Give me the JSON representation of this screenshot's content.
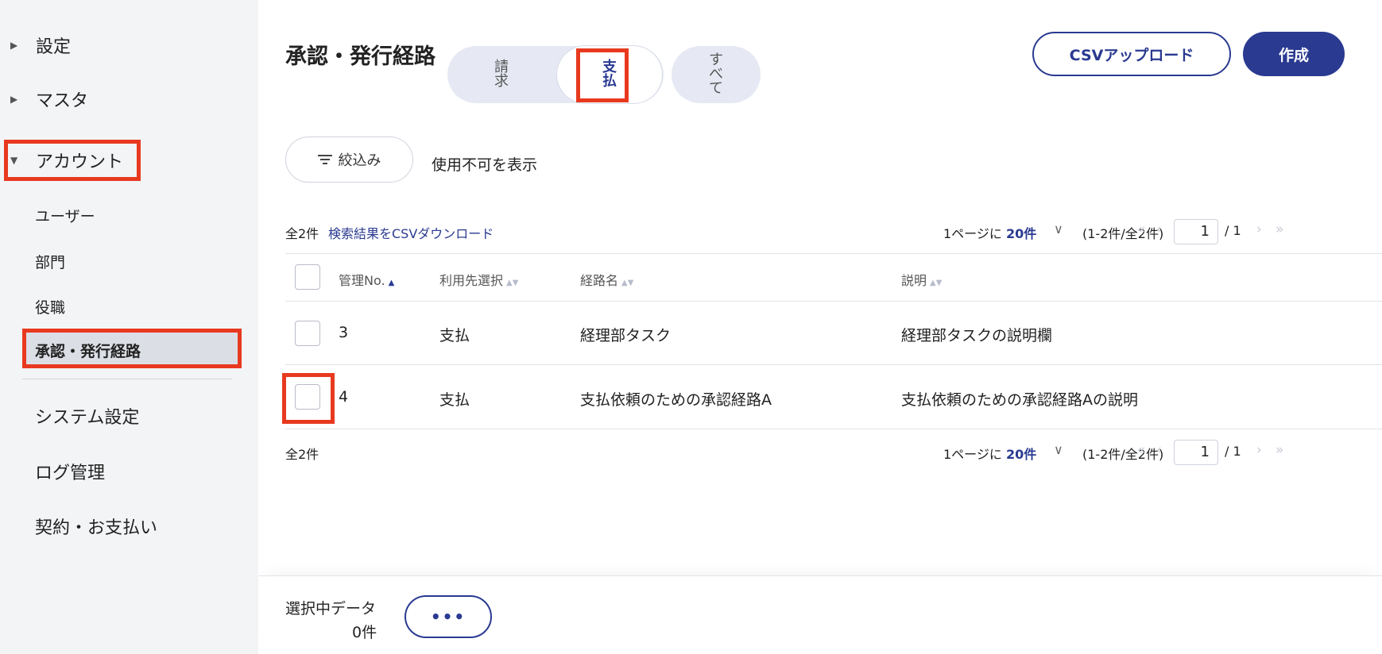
{
  "sidebar": {
    "settings": "設定",
    "master": "マスタ",
    "account": "アカウント",
    "account_children": [
      "ユーザー",
      "部門",
      "役職",
      "承認・発行経路"
    ],
    "system_settings": "システム設定",
    "log_management": "ログ管理",
    "contract_payment": "契約・お支払い",
    "collapsed_icon": "▶",
    "expanded_icon": "▼"
  },
  "header": {
    "title": "承認・発行経路",
    "segments": [
      "請求",
      "支払",
      "すべて"
    ],
    "selected_segment": "支払",
    "csv_upload": "CSVアップロード",
    "create": "作成"
  },
  "filters": {
    "filter_label": "絞込み",
    "show_disabled": "使用不可を表示"
  },
  "pagination_top": {
    "total": "全2件",
    "download": "検索結果をCSVダウンロード",
    "per_page_prefix": "1ページに",
    "per_page": "20件",
    "range": "(1-2件/全2件)",
    "current_page": "1",
    "total_pages": "/ 1"
  },
  "pagination_bottom": {
    "total": "全2件",
    "per_page_prefix": "1ページに",
    "per_page": "20件",
    "range": "(1-2件/全2件)",
    "current_page": "1",
    "total_pages": "/ 1"
  },
  "table": {
    "columns": [
      "管理No.",
      "利用先選択",
      "経路名",
      "説明"
    ],
    "rows": [
      {
        "no": "3",
        "usage": "支払",
        "name": "経理部タスク",
        "description": "経理部タスクの説明欄"
      },
      {
        "no": "4",
        "usage": "支払",
        "name": "支払依頼のための承認経路A",
        "description": "支払依頼のための承認経路Aの説明"
      }
    ]
  },
  "footer": {
    "selected_label": "選択中データ",
    "selected_count": "0件",
    "more": "•••"
  },
  "colors": {
    "accent": "#2a3a91",
    "highlight": "#e8391f",
    "sidebar_bg": "#f3f4f6"
  }
}
